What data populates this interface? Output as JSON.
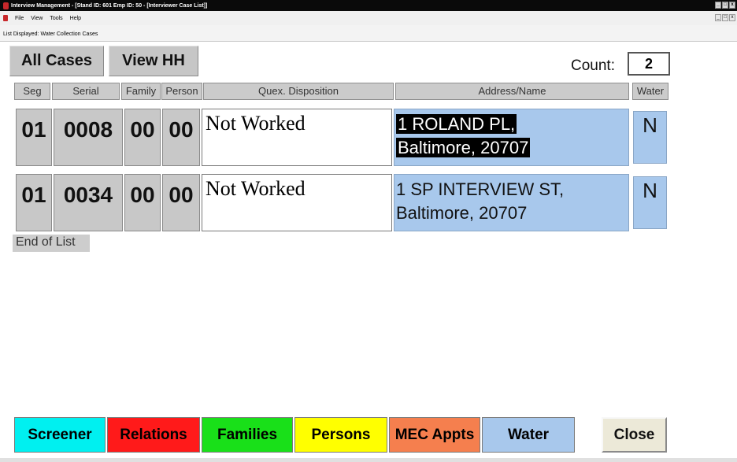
{
  "window": {
    "title": "Interview Management - [Stand ID: 601  Emp ID: 50 - [Interviewer Case List]]",
    "controls": [
      "_",
      "□",
      "x"
    ],
    "mdi_controls": [
      "_",
      "□",
      "x"
    ]
  },
  "menu": [
    "File",
    "View",
    "Tools",
    "Help"
  ],
  "list_label": "List Displayed: Water Collection Cases",
  "toolbar": {
    "all_cases": "All Cases",
    "view_hh": "View HH",
    "count_label": "Count:",
    "count_value": "2"
  },
  "columns": [
    "Seg",
    "Serial",
    "Family",
    "Person",
    "Quex. Disposition",
    "Address/Name",
    "Water"
  ],
  "rows": [
    {
      "seg": "01",
      "serial": "0008",
      "family": "00",
      "person": "00",
      "disposition": "Not Worked",
      "address_line1": "1 ROLAND PL,",
      "address_line2": "Baltimore, 20707",
      "water": "N",
      "selected": true
    },
    {
      "seg": "01",
      "serial": "0034",
      "family": "00",
      "person": "00",
      "disposition": "Not Worked",
      "address_line1": "1 SP INTERVIEW ST,",
      "address_line2": "Baltimore, 20707",
      "water": "N",
      "selected": false
    }
  ],
  "end_of_list": "End of List",
  "bottom_buttons": [
    {
      "label": "Screener",
      "color": "#00f0f0"
    },
    {
      "label": "Relations",
      "color": "#ff1a1a"
    },
    {
      "label": "Families",
      "color": "#19e019"
    },
    {
      "label": "Persons",
      "color": "#ffff00"
    },
    {
      "label": "MEC Appts",
      "color": "#f57f4e"
    },
    {
      "label": "Water",
      "color": "#a8c8ec"
    }
  ],
  "close_label": "Close",
  "colors": {
    "address_cell": "#a8c8ec",
    "selection": "#000000",
    "header_gray": "#cbcbcb"
  }
}
